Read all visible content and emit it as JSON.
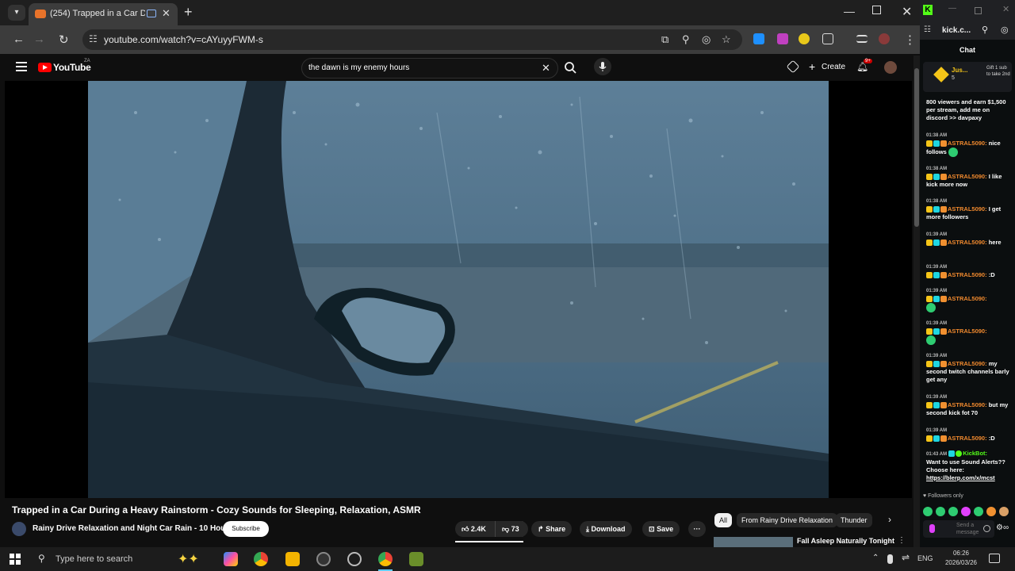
{
  "browser": {
    "tab_title": "(254) Trapped in a Car Durin",
    "url": "youtube.com/watch?v=cAYuyyFWM-s"
  },
  "youtube": {
    "logo_text": "YouTube",
    "country_code": "ZA",
    "search_query": "the dawn is my enemy hours",
    "create_label": "Create",
    "notifications_count": "9+",
    "video": {
      "title": "Trapped in a Car During a Heavy Rainstorm - Cozy Sounds for Sleeping, Relaxation, ASMR",
      "channel": "Rainy Drive Relaxation and Night Car Rain - 10 Hours",
      "subscribe_label": "Subscribe",
      "likes": "2.4K",
      "dislikes": "73",
      "share_label": "Share",
      "download_label": "Download",
      "save_label": "Save"
    },
    "chips": [
      "All",
      "From Rainy Drive Relaxation",
      "Thunder"
    ],
    "up_next_title": "Fall Asleep Naturally Tonight"
  },
  "kick": {
    "url": "kick.c...",
    "chat_title": "Chat",
    "pinned_user": "Jus...",
    "pinned_count": "5",
    "gift_text": "Gift 1 sub to take 2nd",
    "first_message": "800 viewers and earn $1,500 per stream, add me on discord >> davpaxy",
    "messages": [
      {
        "time": "01:38 AM",
        "user": "ASTRAL5090:",
        "text": "nice follows"
      },
      {
        "time": "01:38 AM",
        "user": "ASTRAL5090:",
        "text": "I like kick more now"
      },
      {
        "time": "01:38 AM",
        "user": "ASTRAL5090:",
        "text": "I get more followers"
      },
      {
        "time": "01:39 AM",
        "user": "ASTRAL5090:",
        "text": "here"
      },
      {
        "time": "01:39 AM",
        "user": "ASTRAL5090:",
        "text": ":D"
      },
      {
        "time": "01:39 AM",
        "user": "ASTRAL5090:",
        "text": ""
      },
      {
        "time": "01:39 AM",
        "user": "ASTRAL5090:",
        "text": ""
      },
      {
        "time": "01:39 AM",
        "user": "ASTRAL5090:",
        "text": "my second twitch channels barly get any"
      },
      {
        "time": "01:39 AM",
        "user": "ASTRAL5090:",
        "text": "but my second kick fot 70"
      },
      {
        "time": "01:39 AM",
        "user": "ASTRAL5090:",
        "text": ":D"
      }
    ],
    "bot_message": {
      "time": "01:43 AM",
      "user": "KickBot:",
      "text": "Want to use Sound Alerts?? Choose here:",
      "link": "https://blerp.com/x/mcst"
    },
    "followers_only": "Followers only",
    "send_placeholder": "Send a message"
  },
  "taskbar": {
    "search_placeholder": "Type here to search",
    "language": "ENG",
    "time": "06:26",
    "date": "2026/03/26"
  }
}
